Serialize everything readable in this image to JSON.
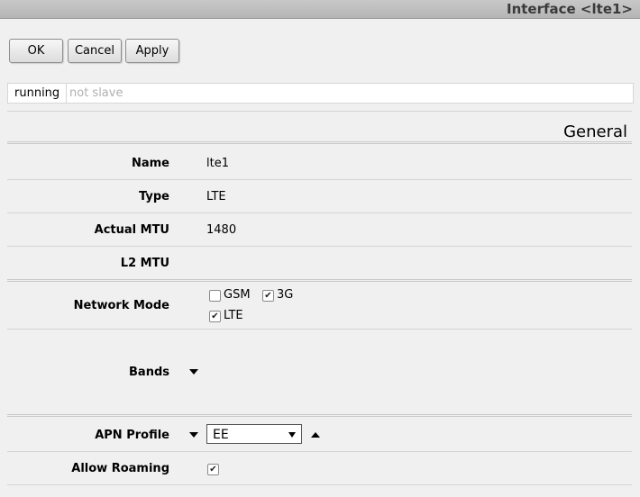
{
  "window": {
    "title": "Interface <lte1>"
  },
  "toolbar": {
    "ok_label": "OK",
    "cancel_label": "Cancel",
    "apply_label": "Apply"
  },
  "status": {
    "running": "running",
    "slave": "not slave"
  },
  "section": {
    "title": "General"
  },
  "fields": {
    "name": {
      "label": "Name",
      "value": "lte1"
    },
    "type": {
      "label": "Type",
      "value": "LTE"
    },
    "actual_mtu": {
      "label": "Actual MTU",
      "value": "1480"
    },
    "l2_mtu": {
      "label": "L2 MTU",
      "value": ""
    },
    "network_mode": {
      "label": "Network Mode",
      "options": [
        {
          "label": "GSM",
          "checked": false
        },
        {
          "label": "3G",
          "checked": true
        },
        {
          "label": "LTE",
          "checked": true
        }
      ]
    },
    "bands": {
      "label": "Bands"
    },
    "apn_profile": {
      "label": "APN Profile",
      "selected": "EE"
    },
    "allow_roaming": {
      "label": "Allow Roaming",
      "checked": true
    }
  },
  "icons": {
    "check": "checkmark-icon",
    "expand": "triangle-down-icon",
    "collapse": "triangle-up-icon"
  }
}
